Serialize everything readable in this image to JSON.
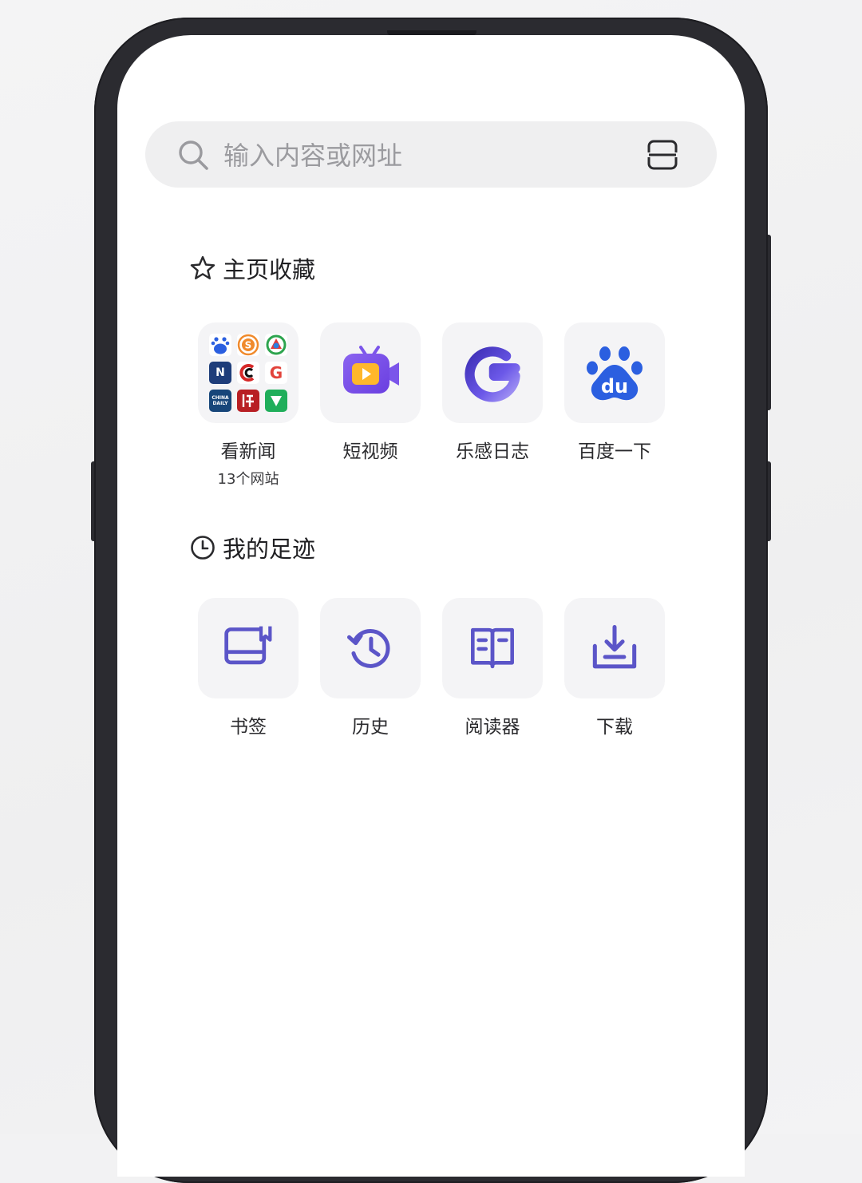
{
  "search": {
    "placeholder": "输入内容或网址"
  },
  "favorites": {
    "title": "主页收藏",
    "items": [
      {
        "label": "看新闻",
        "sub": "13个网站"
      },
      {
        "label": "短视频"
      },
      {
        "label": "乐感日志"
      },
      {
        "label": "百度一下"
      }
    ],
    "news_grid_marks": [
      "du",
      "S",
      "",
      "N",
      "C",
      "G",
      "CHINA DAILY",
      "",
      ""
    ]
  },
  "footprints": {
    "title": "我的足迹",
    "items": [
      {
        "label": "书签",
        "icon": "bookmark-icon"
      },
      {
        "label": "历史",
        "icon": "history-icon"
      },
      {
        "label": "阅读器",
        "icon": "reader-icon"
      },
      {
        "label": "下载",
        "icon": "download-icon"
      }
    ]
  },
  "colors": {
    "accent": "#5b55c8",
    "baidu_blue": "#2b5fe0",
    "tile_bg": "#f4f4f6",
    "search_bg": "#efeff0"
  }
}
